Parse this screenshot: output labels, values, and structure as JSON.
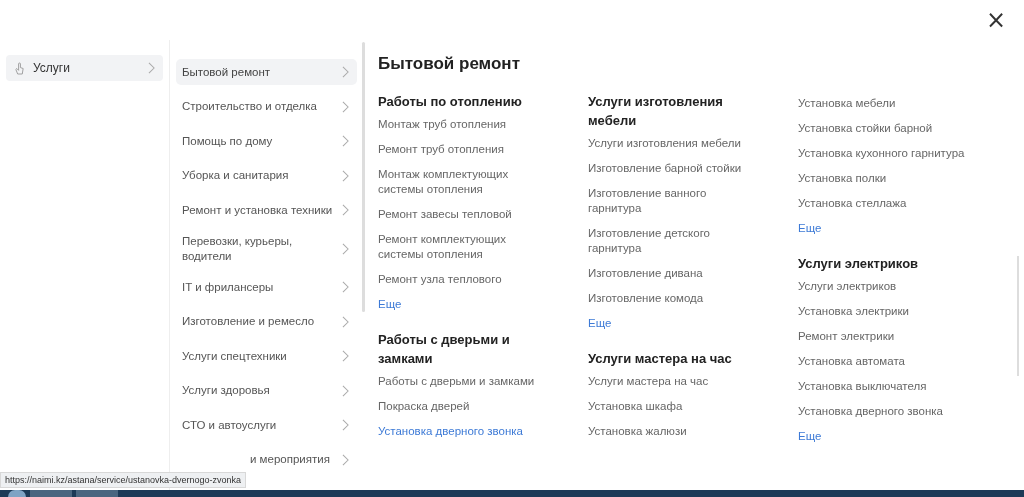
{
  "close_label": "×",
  "root_menu": [
    {
      "label": "Услуги",
      "selected": true
    }
  ],
  "categories": [
    {
      "label": "Бытовой ремонт",
      "selected": true,
      "covered": false
    },
    {
      "label": "Строительство и отделка",
      "selected": false,
      "covered": false
    },
    {
      "label": "Помощь по дому",
      "selected": false,
      "covered": false
    },
    {
      "label": "Уборка и санитария",
      "selected": false,
      "covered": false
    },
    {
      "label": "Ремонт и установка техники",
      "selected": false,
      "covered": false
    },
    {
      "label": "Перевозки, курьеры, водители",
      "selected": false,
      "covered": false
    },
    {
      "label": "IT и фрилансеры",
      "selected": false,
      "covered": false
    },
    {
      "label": "Изготовление и ремесло",
      "selected": false,
      "covered": false
    },
    {
      "label": "Услуги спецтехники",
      "selected": false,
      "covered": false
    },
    {
      "label": "Услуги здоровья",
      "selected": false,
      "covered": false
    },
    {
      "label": "СТО и автоуслуги",
      "selected": false,
      "covered": false
    },
    {
      "label": "и мероприятия",
      "selected": false,
      "covered": true
    }
  ],
  "heading": "Бытовой ремонт",
  "columns": [
    [
      {
        "title": "Работы по отоплению",
        "items": [
          {
            "label": "Монтаж труб отопления",
            "highlighted": false
          },
          {
            "label": "Ремонт труб отопления",
            "highlighted": false
          },
          {
            "label": "Монтаж комплектующих системы отопления",
            "highlighted": false
          },
          {
            "label": "Ремонт завесы тепловой",
            "highlighted": false
          },
          {
            "label": "Ремонт комплектующих системы отопления",
            "highlighted": false
          },
          {
            "label": "Ремонт узла теплового",
            "highlighted": false
          }
        ],
        "more": "Еще"
      },
      {
        "title": "Работы с дверьми и замками",
        "items": [
          {
            "label": "Работы с дверьми и замками",
            "highlighted": false
          },
          {
            "label": "Покраска дверей",
            "highlighted": false
          },
          {
            "label": "Установка дверного звонка",
            "highlighted": true
          }
        ]
      }
    ],
    [
      {
        "title": "Услуги изготовления мебели",
        "items": [
          {
            "label": "Услуги изготовления мебели",
            "highlighted": false
          },
          {
            "label": "Изготовление барной стойки",
            "highlighted": false
          },
          {
            "label": "Изготовление ванного гарнитура",
            "highlighted": false
          },
          {
            "label": "Изготовление детского гарнитура",
            "highlighted": false
          },
          {
            "label": "Изготовление дивана",
            "highlighted": false
          },
          {
            "label": "Изготовление комода",
            "highlighted": false
          }
        ],
        "more": "Еще"
      },
      {
        "title": "Услуги мастера на час",
        "items": [
          {
            "label": "Услуги мастера на час",
            "highlighted": false
          },
          {
            "label": "Установка шкафа",
            "highlighted": false
          },
          {
            "label": "Установка жалюзи",
            "highlighted": false
          }
        ]
      }
    ],
    [
      {
        "items": [
          {
            "label": "Установка мебели",
            "highlighted": false
          },
          {
            "label": "Установка стойки барной",
            "highlighted": false
          },
          {
            "label": "Установка кухонного гарнитура",
            "highlighted": false
          },
          {
            "label": "Установка полки",
            "highlighted": false
          },
          {
            "label": "Установка стеллажа",
            "highlighted": false
          }
        ],
        "more": "Еще"
      },
      {
        "title": "Услуги электриков",
        "items": [
          {
            "label": "Услуги электриков",
            "highlighted": false
          },
          {
            "label": "Установка электрики",
            "highlighted": false
          },
          {
            "label": "Ремонт электрики",
            "highlighted": false
          },
          {
            "label": "Установка автомата",
            "highlighted": false
          },
          {
            "label": "Установка выключателя",
            "highlighted": false
          },
          {
            "label": "Установка дверного звонка",
            "highlighted": false
          }
        ],
        "more": "Еще"
      }
    ]
  ],
  "status_url": "https://naimi.kz/astana/service/ustanovka-dvernogo-zvonka"
}
